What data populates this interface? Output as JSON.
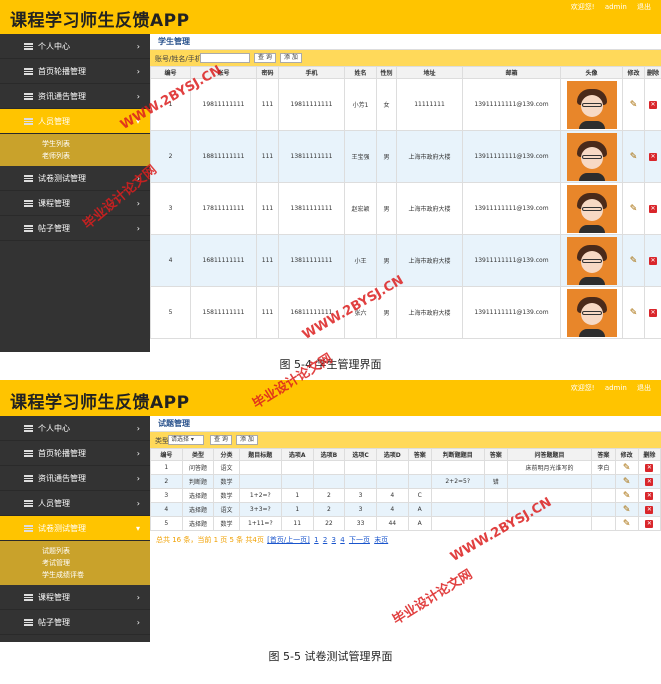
{
  "top": {
    "app_title": "课程学习师生反馈APP",
    "welcome": "欢迎您!",
    "user": "admin",
    "logout": "退出",
    "sidebar": {
      "personal": "个人中心",
      "carousel": "首页轮播管理",
      "notice": "资讯通告管理",
      "people": "人员管理",
      "student_list": "学生列表",
      "teacher_list": "老师列表",
      "exam": "试卷测试管理",
      "course": "课程管理",
      "post": "帖子管理"
    },
    "content_title": "学生管理",
    "toolbar": {
      "label": "账号/姓名/手机",
      "search": "查 询",
      "add": "添 加"
    },
    "columns": [
      "编号",
      "账号",
      "密码",
      "手机",
      "姓名",
      "性别",
      "地址",
      "邮箱",
      "头像",
      "修改",
      "删除"
    ],
    "rows": [
      [
        "1",
        "19811111111",
        "111",
        "19811111111",
        "小芳1",
        "女",
        "11111111",
        "13911111111@139.com"
      ],
      [
        "2",
        "18811111111",
        "111",
        "13811111111",
        "王宝强",
        "男",
        "上海市政府大楼",
        "13911111111@139.com"
      ],
      [
        "3",
        "17811111111",
        "111",
        "13811111111",
        "赵宏颖",
        "男",
        "上海市政府大楼",
        "13911111111@139.com"
      ],
      [
        "4",
        "16811111111",
        "111",
        "13811111111",
        "小王",
        "男",
        "上海市政府大楼",
        "13911111111@139.com"
      ],
      [
        "5",
        "15811111111",
        "111",
        "16811111111",
        "张六",
        "男",
        "上海市政府大楼",
        "13911111111@139.com"
      ]
    ],
    "caption": "图 5-4 学生管理界面"
  },
  "bottom": {
    "app_title": "课程学习师生反馈APP",
    "welcome": "欢迎您!",
    "user": "admin",
    "logout": "退出",
    "sidebar": {
      "personal": "个人中心",
      "carousel": "首页轮播管理",
      "notice": "资讯通告管理",
      "people": "人员管理",
      "exam": "试卷测试管理",
      "exam_list": "试题列表",
      "exam_manage": "考试管理",
      "score_eval": "学生成绩评卷",
      "course": "课程管理",
      "post": "帖子管理"
    },
    "content_title": "试题管理",
    "toolbar": {
      "label": "类型:",
      "select": "请选择",
      "search": "查 询",
      "add": "添 加"
    },
    "columns": [
      "编号",
      "类型",
      "分类",
      "题目标题",
      "选项A",
      "选项B",
      "选项C",
      "选项D",
      "答案",
      "判断题题目",
      "答案",
      "问答题题目",
      "答案",
      "修改",
      "删除"
    ],
    "rows": [
      [
        "1",
        "问答题",
        "语文",
        "",
        "",
        "",
        "",
        "",
        "",
        "",
        "",
        "床前明月光谁写的",
        "李白"
      ],
      [
        "2",
        "判断题",
        "数学",
        "",
        "",
        "",
        "",
        "",
        "",
        "2+2=5?",
        "错",
        "",
        ""
      ],
      [
        "3",
        "选择题",
        "数学",
        "1+2=?",
        "1",
        "2",
        "3",
        "4",
        "C",
        "",
        "",
        "",
        ""
      ],
      [
        "4",
        "选择题",
        "语文",
        "3+3=?",
        "1",
        "2",
        "3",
        "4",
        "A",
        "",
        "",
        "",
        ""
      ],
      [
        "5",
        "选择题",
        "数学",
        "1+11=?",
        "11",
        "22",
        "33",
        "44",
        "A",
        "",
        "",
        "",
        ""
      ]
    ],
    "pager": {
      "summary": "总共 16 条，当前 1 页 5 条 共4页",
      "prev": "[首页/上一页]",
      "p1": "1",
      "p2": "2",
      "p3": "3",
      "p4": "4",
      "next": "下一页",
      "last": "末页"
    },
    "caption": "图 5-5 试卷测试管理界面"
  },
  "watermark": {
    "domain": "WWW.2BYSJ.CN",
    "site": "毕业设计论文网"
  }
}
